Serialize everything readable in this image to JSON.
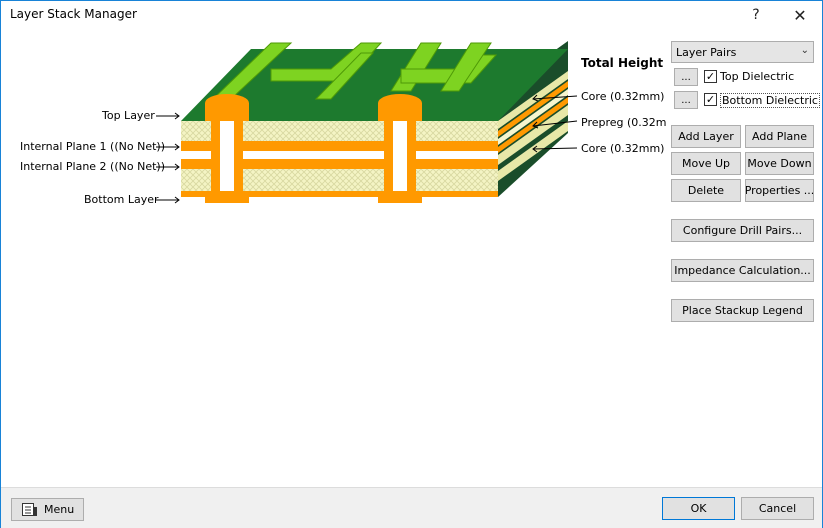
{
  "window": {
    "title": "Layer Stack Manager",
    "help_glyph": "?",
    "close_glyph": "✕"
  },
  "diagram": {
    "labels": {
      "top_layer": "Top Layer",
      "internal_plane_1": "Internal Plane 1 ((No Net))",
      "internal_plane_2": "Internal Plane 2 ((No Net))",
      "bottom_layer": "Bottom Layer",
      "total_height": "Total Height",
      "core_top": "Core (0.32mm)",
      "prepreg": "Prepreg (0.32m",
      "core_bottom": "Core (0.32mm)"
    },
    "colors": {
      "green_dark": "#1d7a2e",
      "green_light": "#7ed321",
      "copper": "#ff9900",
      "dielectric": "#f5f5c8",
      "side": "#1a4d2a"
    }
  },
  "panel": {
    "dropdown_value": "Layer Pairs",
    "dots": "...",
    "top_dielectric": {
      "label": "Top Dielectric",
      "checked": true
    },
    "bottom_dielectric": {
      "label": "Bottom Dielectric",
      "checked": true
    },
    "check_glyph": "✓",
    "buttons": {
      "add_layer": "Add Layer",
      "add_plane": "Add Plane",
      "move_up": "Move Up",
      "move_down": "Move Down",
      "delete": "Delete",
      "properties": "Properties ...",
      "configure_drill_pairs": "Configure Drill Pairs...",
      "impedance_calculation": "Impedance Calculation...",
      "place_stackup_legend": "Place Stackup Legend"
    }
  },
  "footer": {
    "menu": "Menu",
    "ok": "OK",
    "cancel": "Cancel"
  }
}
